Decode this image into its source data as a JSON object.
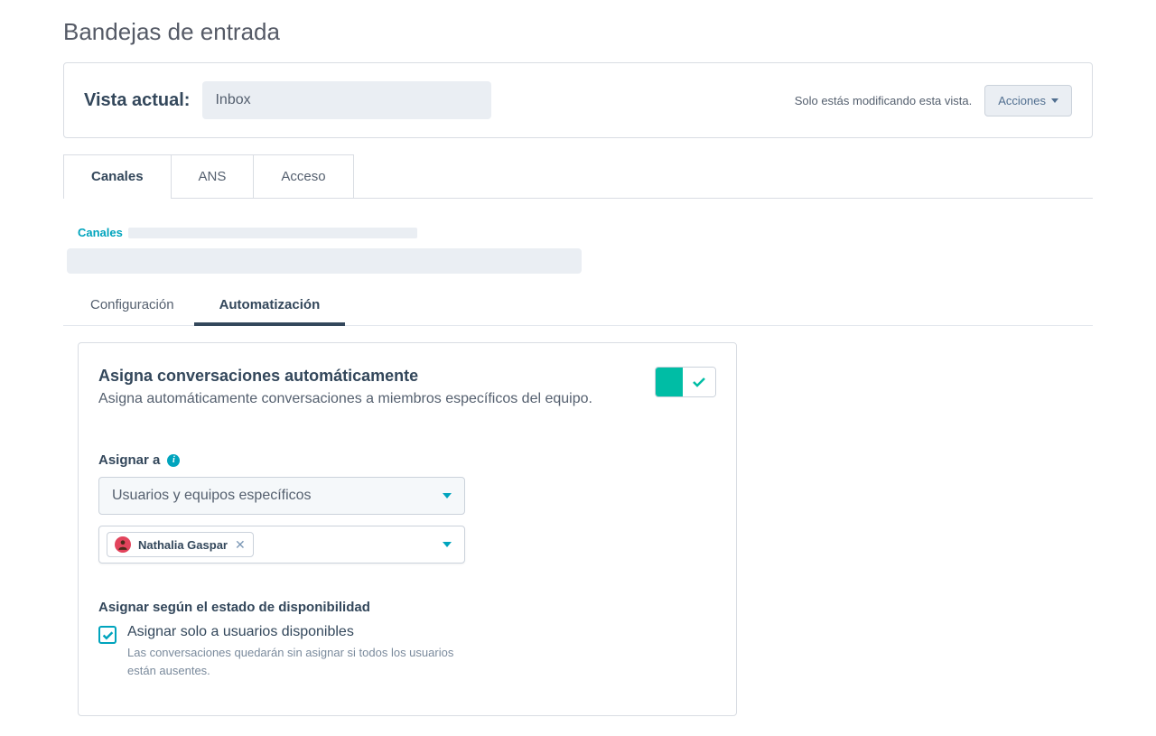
{
  "page": {
    "title": "Bandejas de entrada"
  },
  "viewBar": {
    "label": "Vista actual:",
    "input_value": "Inbox",
    "note": "Solo estás modificando esta vista.",
    "actions_label": "Acciones"
  },
  "mainTabs": [
    {
      "label": "Canales",
      "active": true
    },
    {
      "label": "ANS",
      "active": false
    },
    {
      "label": "Acceso",
      "active": false
    }
  ],
  "breadcrumb": {
    "root": "Canales"
  },
  "subTabs": [
    {
      "label": "Configuración",
      "active": false
    },
    {
      "label": "Automatización",
      "active": true
    }
  ],
  "autoAssign": {
    "title": "Asigna conversaciones automáticamente",
    "desc": "Asigna automáticamente conversaciones a miembros específicos del equipo.",
    "toggle_on": true
  },
  "assignTo": {
    "label": "Asignar a",
    "select_value": "Usuarios y equipos específicos",
    "selected_user": "Nathalia Gaspar"
  },
  "availability": {
    "label": "Asignar según el estado de disponibilidad",
    "checkbox_label": "Asignar solo a usuarios disponibles",
    "checkbox_checked": true,
    "help_text": "Las conversaciones quedarán sin asignar si todos los usuarios están ausentes."
  },
  "colors": {
    "teal": "#00a4bd",
    "toggle_green": "#00bda5"
  }
}
